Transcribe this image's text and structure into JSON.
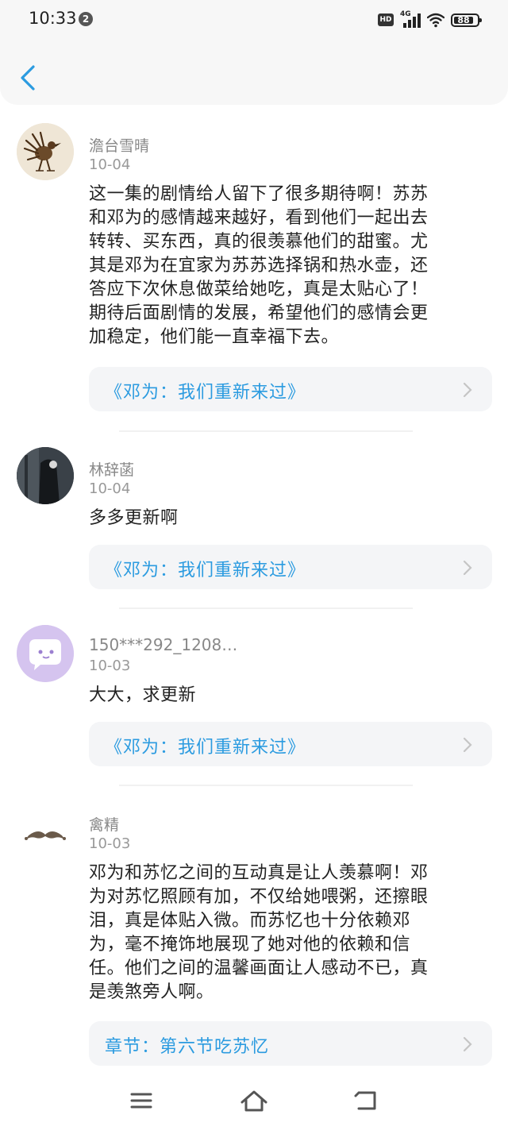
{
  "status_bar": {
    "time": "10:33",
    "notification_count": "2",
    "hd_label": "HD",
    "network": "4G",
    "battery": "88"
  },
  "colors": {
    "link": "#2b9be0",
    "back_arrow": "#2b9be0",
    "muted_text": "#888888"
  },
  "comments": [
    {
      "username": "澹台雪晴",
      "date": "10-04",
      "lines": [
        "这一集的剧情给人留下了很多期待啊！苏苏",
        "和邓为的感情越来越好，看到他们一起出去",
        "转转、买东西，真的很羡慕他们的甜蜜。尤",
        "其是邓为在宜家为苏苏选择锅和热水壶，还",
        "答应下次休息做菜给她吃，真是太贴心了！",
        "期待后面剧情的发展，希望他们的感情会更",
        "加稳定，他们能一直幸福下去。"
      ],
      "link": "《邓为：我们重新来过》"
    },
    {
      "username": "林辞菡",
      "date": "10-04",
      "lines": [
        "多多更新啊"
      ],
      "link": "《邓为：我们重新来过》"
    },
    {
      "username": "150***292_1208…",
      "date": "10-03",
      "lines": [
        "大大，求更新"
      ],
      "link": "《邓为：我们重新来过》"
    },
    {
      "username": "禽精",
      "date": "10-03",
      "lines": [
        "邓为和苏忆之间的互动真是让人羡慕啊！邓",
        "为对苏忆照顾有加，不仅给她喂粥，还擦眼",
        "泪，真是体贴入微。而苏忆也十分依赖邓",
        "为，毫不掩饰地展现了她对他的依赖和信",
        "任。他们之间的温馨画面让人感动不已，真",
        "是羡煞旁人啊。"
      ],
      "link": "章节：第六节吃苏忆"
    }
  ]
}
